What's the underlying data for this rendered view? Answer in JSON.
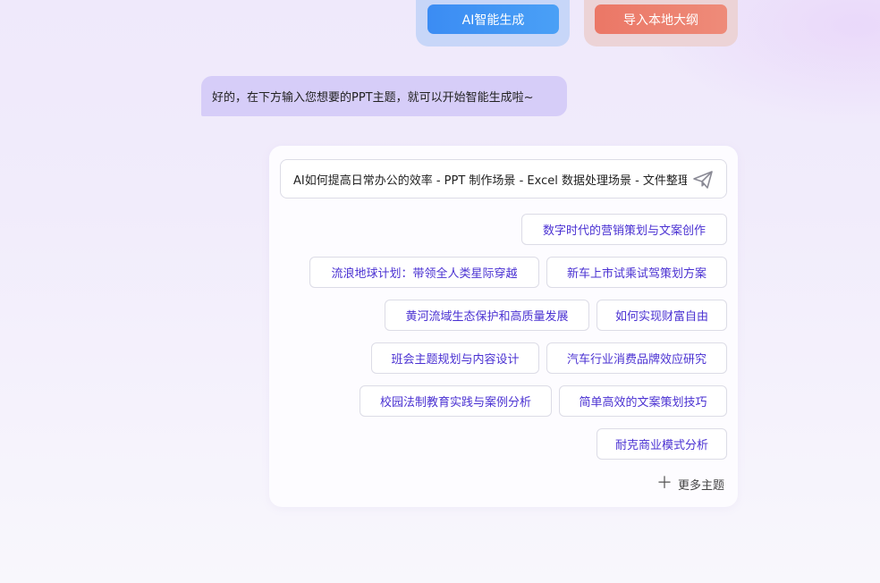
{
  "top_actions": {
    "ai_generate": "AI智能生成",
    "import_outline": "导入本地大纲"
  },
  "bot_message": "好的，在下方输入您想要的PPT主题，就可以开始智能生成啦~",
  "topic_input": {
    "value": "AI如何提高日常办公的效率 - PPT 制作场景 - Excel 数据处理场景 - 文件整理场景"
  },
  "suggestions": [
    "数字时代的营销策划与文案创作",
    "流浪地球计划：带领全人类星际穿越",
    "新车上市试乘试驾策划方案",
    "黄河流域生态保护和高质量发展",
    "如何实现财富自由",
    "班会主题规划与内容设计",
    "汽车行业消费品牌效应研究",
    "校园法制教育实践与案例分析",
    "简单高效的文案策划技巧",
    "耐克商业模式分析"
  ],
  "more_topics": "更多主题",
  "icons": {
    "send": "paper-plane-icon",
    "more": "plus-icon"
  },
  "colors": {
    "accent_blue": "#3b8cf3",
    "accent_orange": "#eb7766",
    "chip_text": "#4a31d2",
    "bubble": "#d6cdf8"
  }
}
